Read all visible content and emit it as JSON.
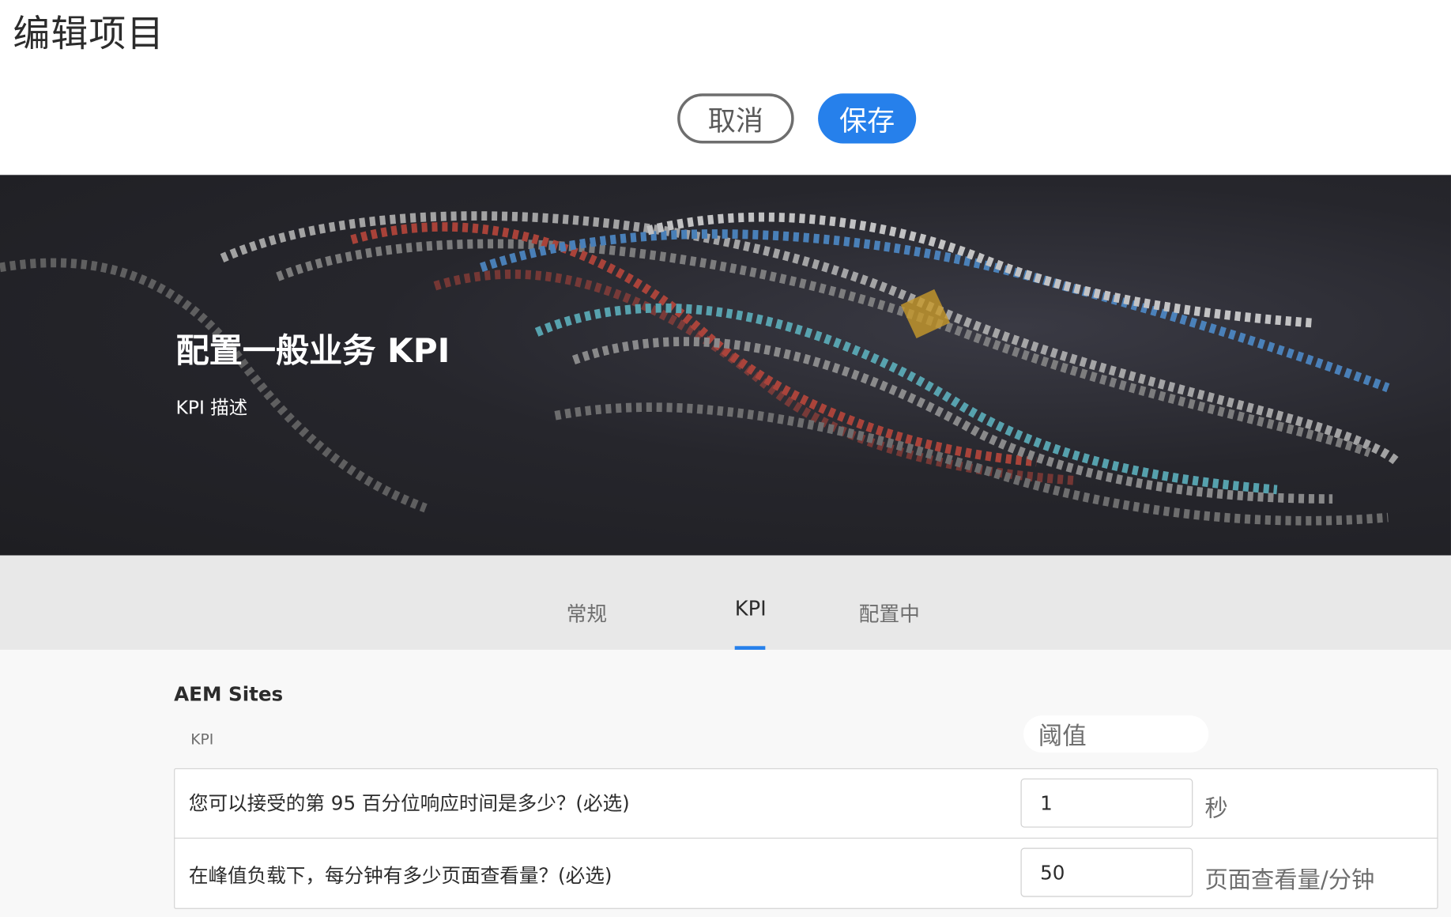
{
  "header": {
    "title": "编辑项目",
    "cancel_label": "取消",
    "save_label": "保存"
  },
  "hero": {
    "title": "配置一般业务 KPI",
    "description": "KPI 描述"
  },
  "tabs": [
    {
      "label": "常规",
      "active": false
    },
    {
      "label": "KPI",
      "active": true
    },
    {
      "label": "配置中",
      "active": false
    }
  ],
  "section": {
    "title": "AEM Sites",
    "col_kpi": "KPI",
    "col_threshold": "阈值"
  },
  "rows": [
    {
      "question": "您可以接受的第 95 百分位响应时间是多少？(必选)",
      "value": "1",
      "unit": "秒"
    },
    {
      "question": "在峰值负载下，每分钟有多少页面查看量？(必选)",
      "value": "50",
      "unit": "页面查看量/分钟"
    }
  ],
  "colors": {
    "accent": "#2680eb",
    "hero_bg": "#26262c",
    "tabbar_bg": "#e8e8e8"
  }
}
